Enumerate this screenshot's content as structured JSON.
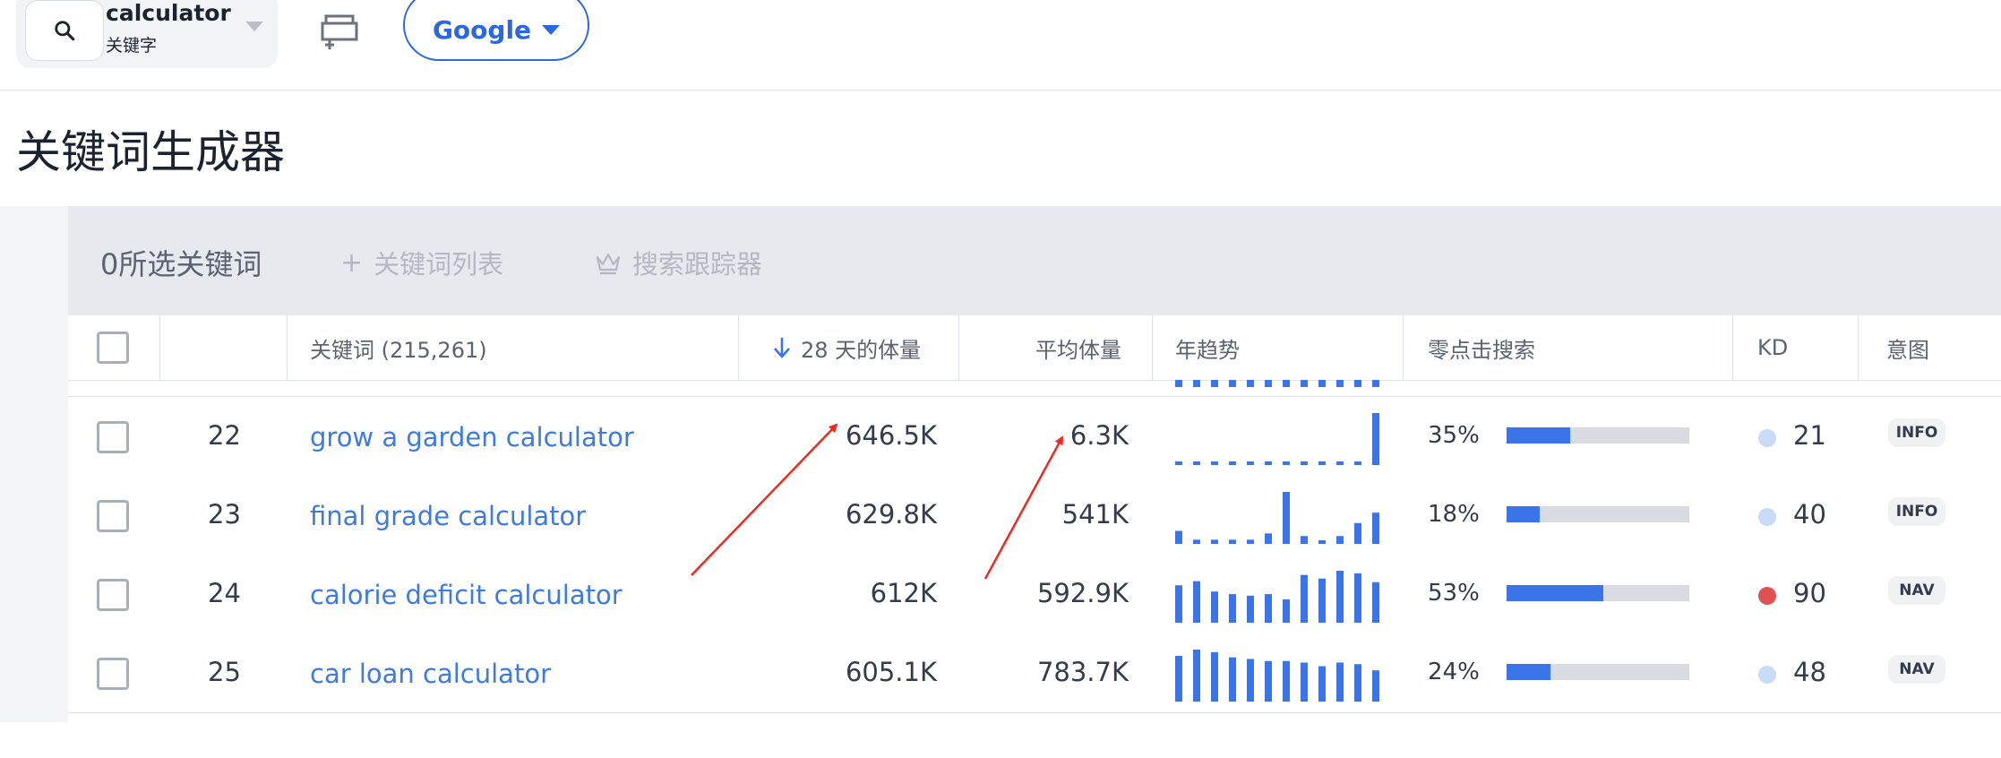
{
  "topbar": {
    "keyword": "calculator",
    "keyword_type": "关键字",
    "engine": "Google"
  },
  "page_title": "关键词生成器",
  "actionbar": {
    "selected": "0所选关键词",
    "keyword_list": "关键词列表",
    "search_tracker": "搜索跟踪器"
  },
  "columns": {
    "keyword": "关键词 (215,261)",
    "volume": "28 天的体量",
    "avg_volume": "平均体量",
    "trend": "年趋势",
    "zero_click": "零点击搜索",
    "kd": "KD",
    "intent": "意图"
  },
  "colors": {
    "accent": "#3b73e8",
    "link": "#3d7be0",
    "kd_low": "#c9dcf7",
    "kd_high": "#e05252",
    "annotation": "#ee2a1f"
  },
  "rows": [
    {
      "num": "22",
      "keyword": "grow a garden calculator",
      "volume": "646.5K",
      "avg_volume": "6.3K",
      "trend": [
        0.05,
        0.05,
        0.05,
        0.05,
        0.05,
        0.05,
        0.05,
        0.05,
        0.05,
        0.05,
        0.05,
        1.0
      ],
      "zero_click": "35%",
      "zero_click_value": 0.35,
      "kd": "21",
      "kd_level": "low",
      "intent": "INFO"
    },
    {
      "num": "23",
      "keyword": "final grade calculator",
      "volume": "629.8K",
      "avg_volume": "541K",
      "trend": [
        0.25,
        0.08,
        0.08,
        0.08,
        0.08,
        0.2,
        1.0,
        0.15,
        0.05,
        0.15,
        0.4,
        0.6
      ],
      "zero_click": "18%",
      "zero_click_value": 0.18,
      "kd": "40",
      "kd_level": "low",
      "intent": "INFO"
    },
    {
      "num": "24",
      "keyword": "calorie deficit calculator",
      "volume": "612K",
      "avg_volume": "592.9K",
      "trend": [
        0.72,
        0.8,
        0.6,
        0.55,
        0.52,
        0.55,
        0.45,
        0.92,
        0.85,
        1.0,
        0.95,
        0.78
      ],
      "zero_click": "53%",
      "zero_click_value": 0.53,
      "kd": "90",
      "kd_level": "high",
      "intent": "NAV"
    },
    {
      "num": "25",
      "keyword": "car loan calculator",
      "volume": "605.1K",
      "avg_volume": "783.7K",
      "trend": [
        0.88,
        1.0,
        0.95,
        0.85,
        0.82,
        0.78,
        0.78,
        0.75,
        0.68,
        0.75,
        0.72,
        0.6
      ],
      "zero_click": "24%",
      "zero_click_value": 0.24,
      "kd": "48",
      "kd_level": "low",
      "intent": "NAV"
    }
  ]
}
